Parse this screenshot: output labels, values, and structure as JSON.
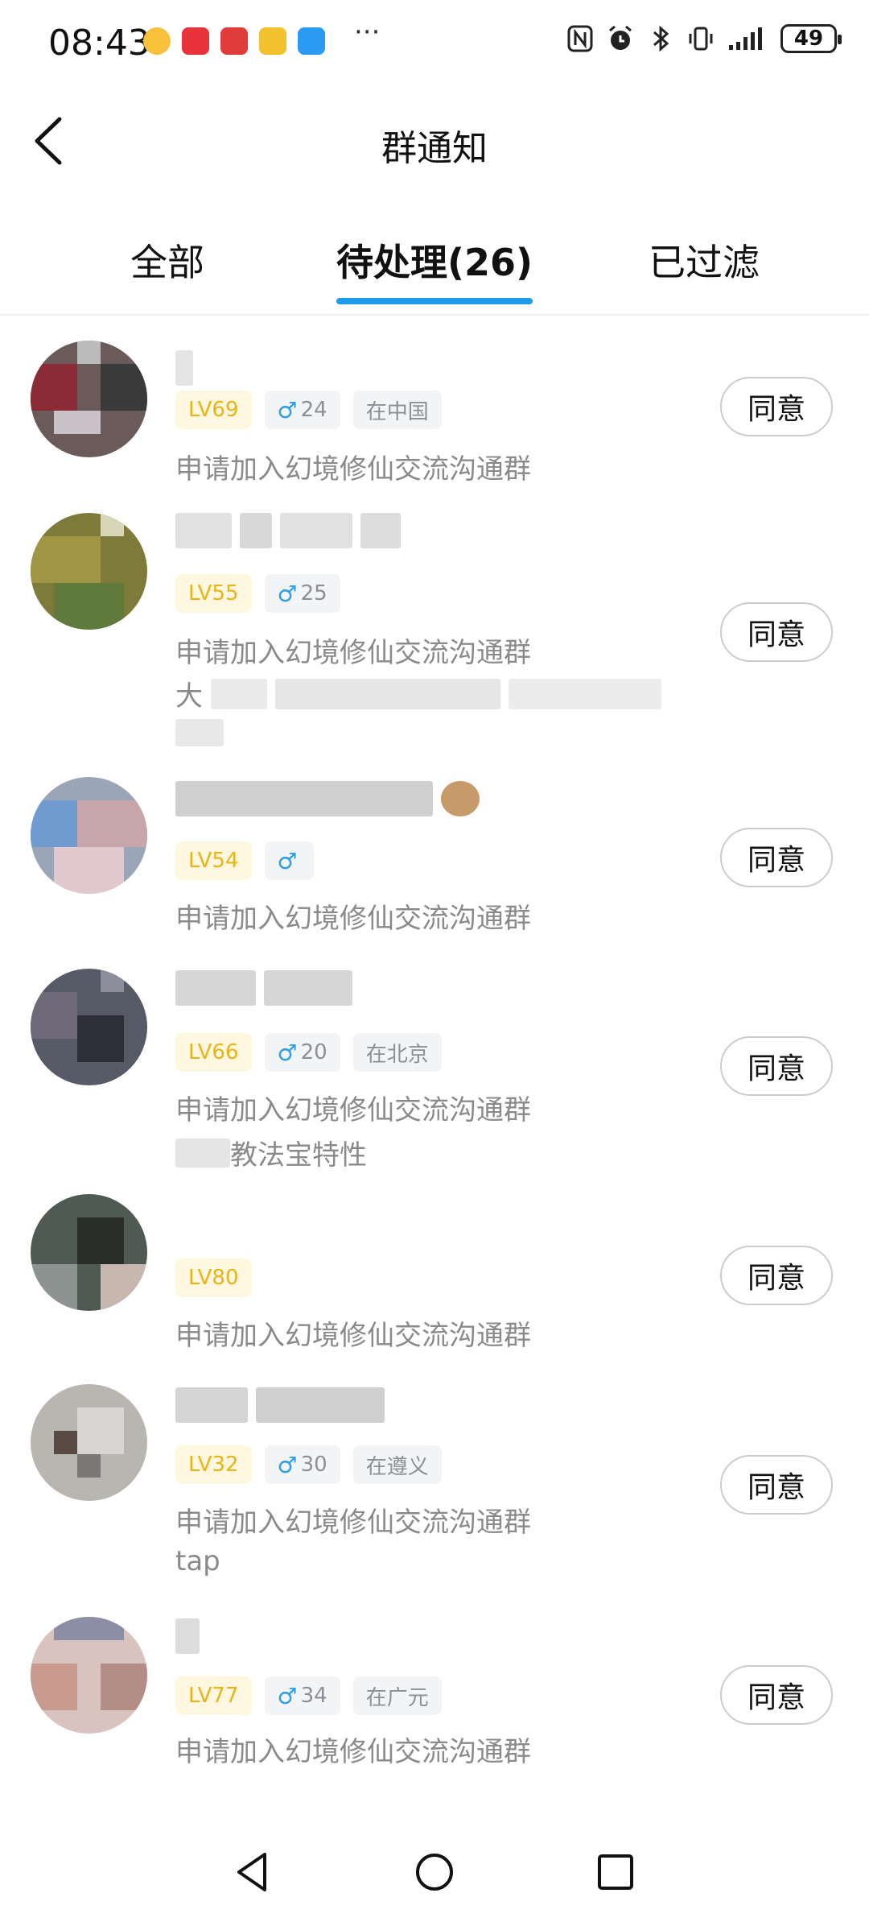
{
  "status_bar": {
    "time": "08:43",
    "more": "···",
    "battery": "49"
  },
  "header": {
    "title": "群通知"
  },
  "tabs": [
    {
      "label": "全部"
    },
    {
      "label": "待处理(26)"
    },
    {
      "label": "已过滤"
    }
  ],
  "requests": [
    {
      "level": "LV69",
      "gender": "♂",
      "age": "24",
      "location": "在中国",
      "text": "申请加入幻境修仙交流沟通群",
      "extra": "",
      "button": "同意"
    },
    {
      "level": "LV55",
      "gender": "♂",
      "age": "25",
      "location": "",
      "text": "申请加入幻境修仙交流沟通群",
      "extra": "大",
      "button": "同意"
    },
    {
      "level": "LV54",
      "gender": "♂",
      "age": "",
      "location": "",
      "text": "申请加入幻境修仙交流沟通群",
      "extra": "",
      "button": "同意"
    },
    {
      "level": "LV66",
      "gender": "♂",
      "age": "20",
      "location": "在北京",
      "text": "申请加入幻境修仙交流沟通群",
      "extra": "教法宝特性",
      "button": "同意"
    },
    {
      "level": "LV80",
      "gender": "",
      "age": "",
      "location": "",
      "text": "申请加入幻境修仙交流沟通群",
      "extra": "",
      "button": "同意"
    },
    {
      "level": "LV32",
      "gender": "♂",
      "age": "30",
      "location": "在遵义",
      "text": "申请加入幻境修仙交流沟通群",
      "extra": "tap",
      "button": "同意"
    },
    {
      "level": "LV77",
      "gender": "♂",
      "age": "34",
      "location": "在广元",
      "text": "申请加入幻境修仙交流沟通群",
      "extra": "",
      "button": "同意"
    }
  ],
  "colors": {
    "accent": "#1e9bf0",
    "level_text": "#e8b417",
    "level_bg": "#fff7df",
    "muted_text": "#8a8a8a"
  },
  "icons": {
    "back": "back-arrow-icon",
    "nav_back": "triangle-back-icon",
    "nav_home": "circle-home-icon",
    "nav_recents": "square-recents-icon"
  }
}
